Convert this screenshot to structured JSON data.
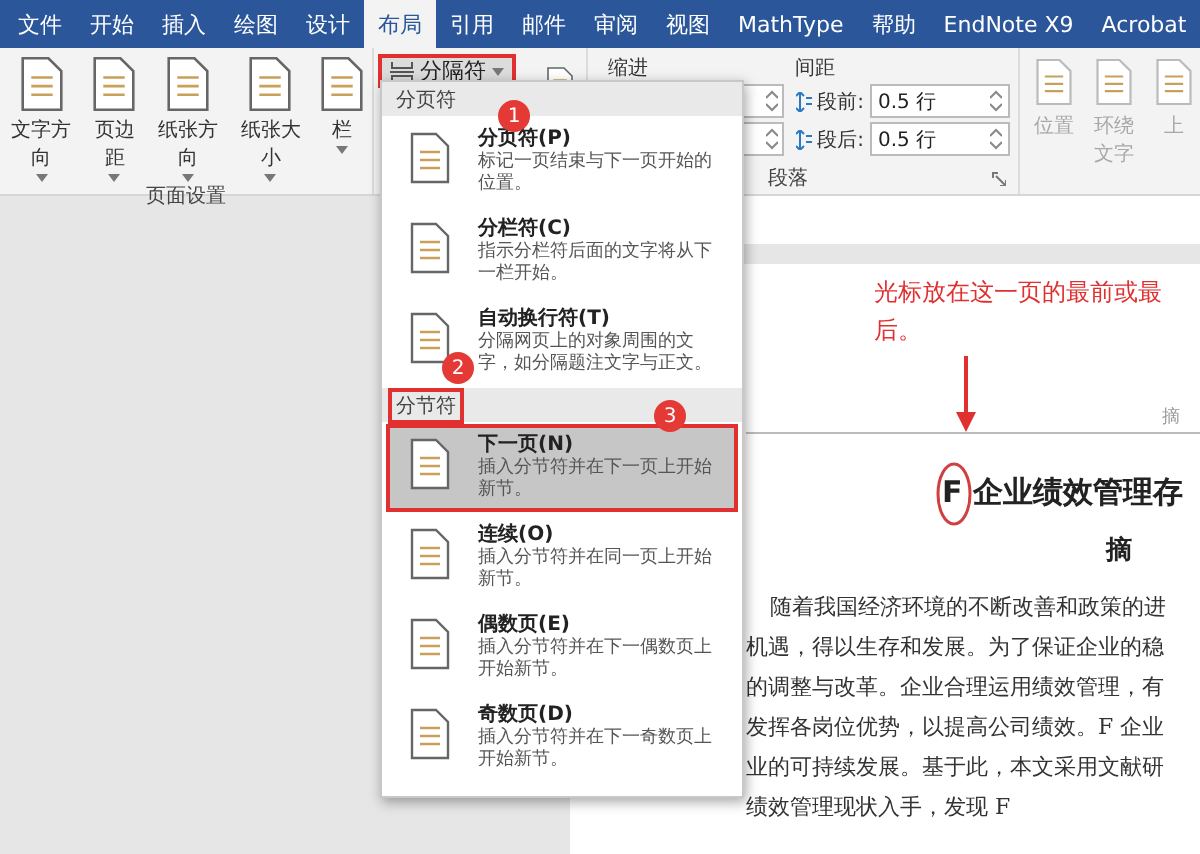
{
  "tabs": [
    {
      "label": "文件",
      "selected": false
    },
    {
      "label": "开始",
      "selected": false
    },
    {
      "label": "插入",
      "selected": false
    },
    {
      "label": "绘图",
      "selected": false
    },
    {
      "label": "设计",
      "selected": false
    },
    {
      "label": "布局",
      "selected": true
    },
    {
      "label": "引用",
      "selected": false
    },
    {
      "label": "邮件",
      "selected": false
    },
    {
      "label": "审阅",
      "selected": false
    },
    {
      "label": "视图",
      "selected": false
    },
    {
      "label": "MathType",
      "selected": false
    },
    {
      "label": "帮助",
      "selected": false
    },
    {
      "label": "EndNote X9",
      "selected": false
    },
    {
      "label": "Acrobat",
      "selected": false
    }
  ],
  "ribbon": {
    "page_setup": {
      "buttons": [
        "文字方向",
        "页边距",
        "纸张方向",
        "纸张大小",
        "栏"
      ],
      "label": "页面设置"
    },
    "breaks_button": {
      "label": "分隔符",
      "outlined": true
    },
    "paragraph": {
      "indent_label": "缩进",
      "spacing_label": "间距",
      "spacing": [
        {
          "label": "段前:",
          "value": "0.5 行"
        },
        {
          "label": "段后:",
          "value": "0.5 行"
        }
      ],
      "label": "段落"
    },
    "arrange": [
      {
        "label": "位置",
        "disabled": true
      },
      {
        "label": "环绕文字",
        "disabled": true
      },
      {
        "label": "上",
        "disabled": true
      }
    ]
  },
  "breaks_menu": [
    {
      "header": "分页符",
      "outlined": false,
      "items": [
        {
          "title": "分页符(P)",
          "description": "标记一页结束与下一页开始的位置。",
          "selected": false,
          "outlined": false
        },
        {
          "title": "分栏符(C)",
          "description": "指示分栏符后面的文字将从下一栏开始。",
          "selected": false,
          "outlined": false
        },
        {
          "title": "自动换行符(T)",
          "description": "分隔网页上的对象周围的文字，如分隔题注文字与正文。",
          "selected": false,
          "outlined": false
        }
      ]
    },
    {
      "header": "分节符",
      "outlined": true,
      "items": [
        {
          "title": "下一页(N)",
          "description": "插入分节符并在下一页上开始新节。",
          "selected": true,
          "outlined": true
        },
        {
          "title": "连续(O)",
          "description": "插入分节符并在同一页上开始新节。",
          "selected": false,
          "outlined": false
        },
        {
          "title": "偶数页(E)",
          "description": "插入分节符并在下一偶数页上开始新节。",
          "selected": false,
          "outlined": false
        },
        {
          "title": "奇数页(D)",
          "description": "插入分节符并在下一奇数页上开始新节。",
          "selected": false,
          "outlined": false
        }
      ]
    }
  ],
  "document": {
    "header": "摘",
    "title": "F 企业绩效管理存",
    "subtitle": "摘",
    "lines": [
      "随着我国经济环境的不断改善和政策的进",
      "机遇，得以生存和发展。为了保证企业的稳",
      "的调整与改革。企业合理运用绩效管理，有",
      "发挥各岗位优势，以提高公司绩效。F 企业",
      "业的可持续发展。基于此，本文采用文献研",
      "绩效管理现状入手，发现 F"
    ]
  },
  "annotations": {
    "note": "光标放在这一页的最前或最后。",
    "steps": [
      "1",
      "2",
      "3"
    ]
  }
}
